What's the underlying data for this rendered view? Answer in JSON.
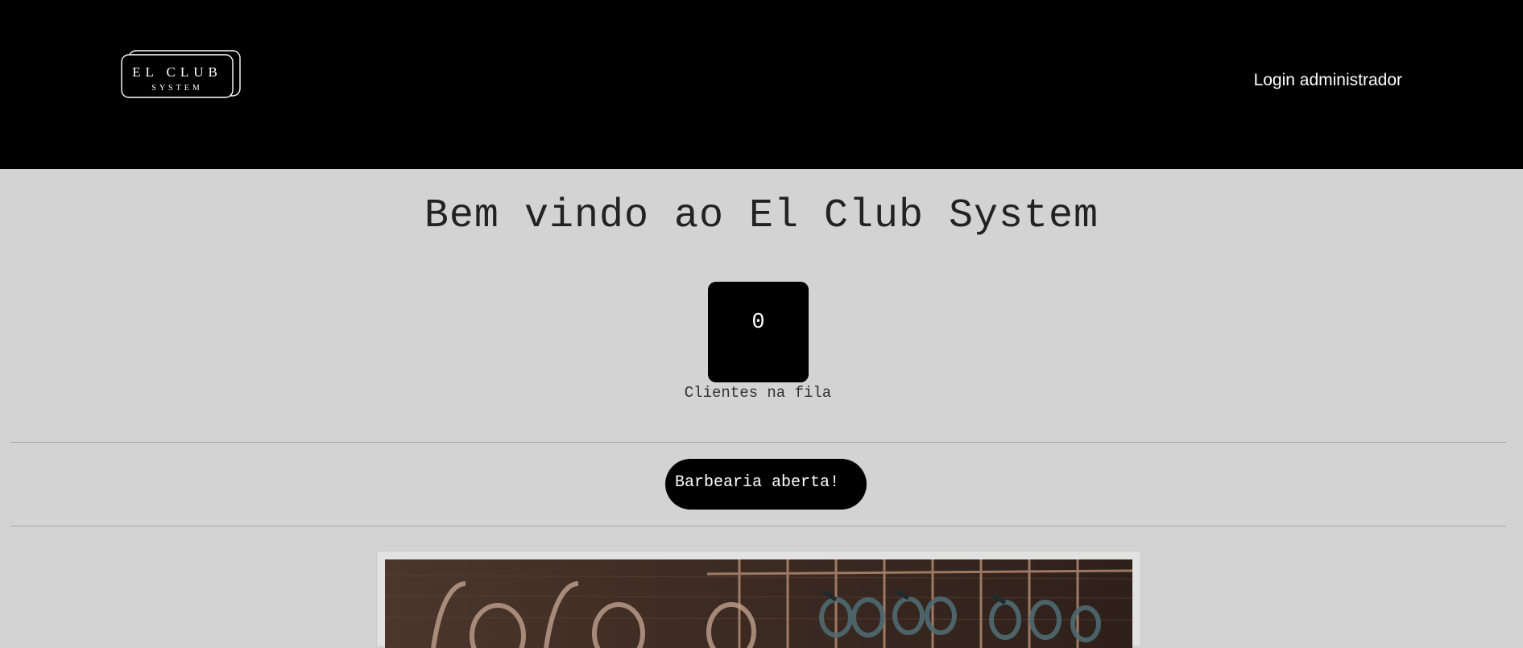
{
  "header": {
    "logo": {
      "line1": "EL CLUB",
      "line2": "SYSTEM"
    },
    "admin_login_label": "Login administrador"
  },
  "main": {
    "welcome_title": "Bem vindo ao El Club System",
    "queue": {
      "count": "0",
      "label": "Clientes na fila"
    },
    "status_button_label": "Barbearia aberta!",
    "image": {
      "subject": "barber tools hanging on rack"
    }
  },
  "colors": {
    "header_bg": "#000000",
    "page_bg": "#d3d3d3",
    "accent": "#000000",
    "text": "#222222"
  }
}
